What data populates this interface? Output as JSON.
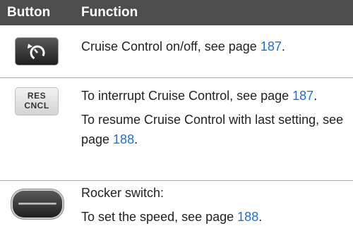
{
  "header": {
    "button": "Button",
    "function": "Function"
  },
  "rows": [
    {
      "button_icon": "cruise-control-icon",
      "function": [
        {
          "text": "Cruise Control on/off, see page ",
          "link": "187",
          "suffix": "."
        }
      ]
    },
    {
      "button_icon": "res-cncl-icon",
      "button_label_line1": "RES",
      "button_label_line2": "CNCL",
      "function": [
        {
          "text": "To interrupt Cruise Control, see page ",
          "link": "187",
          "suffix": "."
        },
        {
          "text": "To resume Cruise Control with last setting, see page ",
          "link": "188",
          "suffix": "."
        }
      ]
    },
    {
      "button_icon": "rocker-switch-icon",
      "function": [
        {
          "text": "Rocker switch:"
        },
        {
          "text": "To set the speed, see page ",
          "link": "188",
          "suffix": "."
        }
      ]
    }
  ]
}
